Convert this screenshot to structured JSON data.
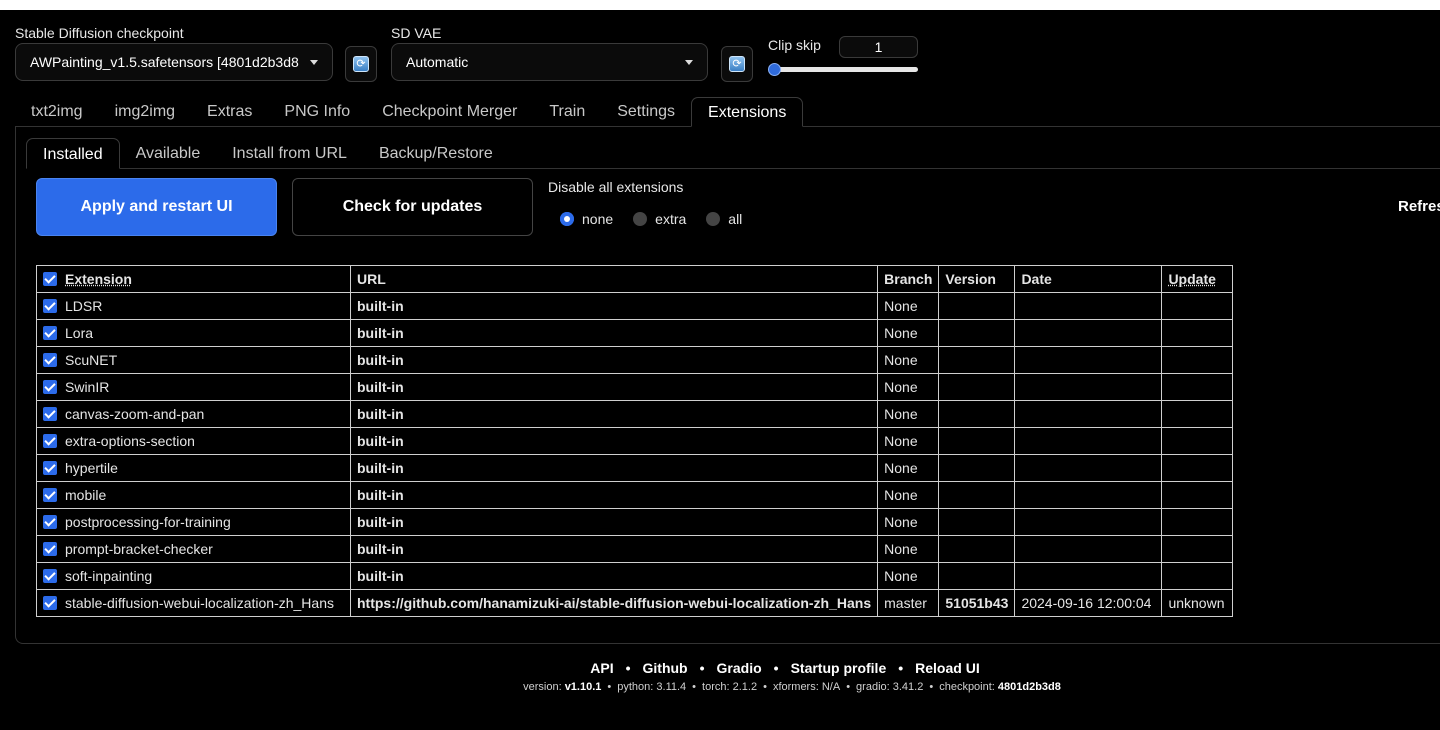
{
  "settings": {
    "checkpoint_label": "Stable Diffusion checkpoint",
    "checkpoint_value": "AWPainting_v1.5.safetensors [4801d2b3d8",
    "vae_label": "SD VAE",
    "vae_value": "Automatic",
    "clip_skip_label": "Clip skip",
    "clip_skip_value": "1",
    "refresh_glyph": "⟳"
  },
  "tabs": [
    "txt2img",
    "img2img",
    "Extras",
    "PNG Info",
    "Checkpoint Merger",
    "Train",
    "Settings",
    "Extensions"
  ],
  "subtabs": [
    "Installed",
    "Available",
    "Install from URL",
    "Backup/Restore"
  ],
  "actions": {
    "apply_label": "Apply and restart UI",
    "check_label": "Check for updates",
    "disable_label": "Disable all extensions",
    "radio": [
      "none",
      "extra",
      "all"
    ],
    "refresh_label": "Refres"
  },
  "table": {
    "headers": [
      "Extension",
      "URL",
      "Branch",
      "Version",
      "Date",
      "Update"
    ],
    "rows": [
      [
        "LDSR",
        "built-in",
        "None",
        "",
        "",
        ""
      ],
      [
        "Lora",
        "built-in",
        "None",
        "",
        "",
        ""
      ],
      [
        "ScuNET",
        "built-in",
        "None",
        "",
        "",
        ""
      ],
      [
        "SwinIR",
        "built-in",
        "None",
        "",
        "",
        ""
      ],
      [
        "canvas-zoom-and-pan",
        "built-in",
        "None",
        "",
        "",
        ""
      ],
      [
        "extra-options-section",
        "built-in",
        "None",
        "",
        "",
        ""
      ],
      [
        "hypertile",
        "built-in",
        "None",
        "",
        "",
        ""
      ],
      [
        "mobile",
        "built-in",
        "None",
        "",
        "",
        ""
      ],
      [
        "postprocessing-for-training",
        "built-in",
        "None",
        "",
        "",
        ""
      ],
      [
        "prompt-bracket-checker",
        "built-in",
        "None",
        "",
        "",
        ""
      ],
      [
        "soft-inpainting",
        "built-in",
        "None",
        "",
        "",
        ""
      ],
      [
        "stable-diffusion-webui-localization-zh_Hans",
        "https://github.com/hanamizuki-ai/stable-diffusion-webui-localization-zh_Hans",
        "master",
        "51051b43",
        "2024-09-16 12:00:04",
        "unknown"
      ]
    ]
  },
  "footer": {
    "links": [
      "API",
      "Github",
      "Gradio",
      "Startup profile",
      "Reload UI"
    ],
    "sep": "•",
    "versions": [
      {
        "k": "version: ",
        "v": "v1.10.1",
        "bold": true
      },
      {
        "k": "python: ",
        "v": "3.11.4",
        "bold": false
      },
      {
        "k": "torch: ",
        "v": "2.1.2",
        "bold": false
      },
      {
        "k": "xformers: ",
        "v": "N/A",
        "bold": false
      },
      {
        "k": "gradio: ",
        "v": "3.41.2",
        "bold": false
      },
      {
        "k": "checkpoint: ",
        "v": "4801d2b3d8",
        "bold": true
      }
    ]
  },
  "colors": {
    "accent": "#2c6bea",
    "background": "#000000"
  }
}
